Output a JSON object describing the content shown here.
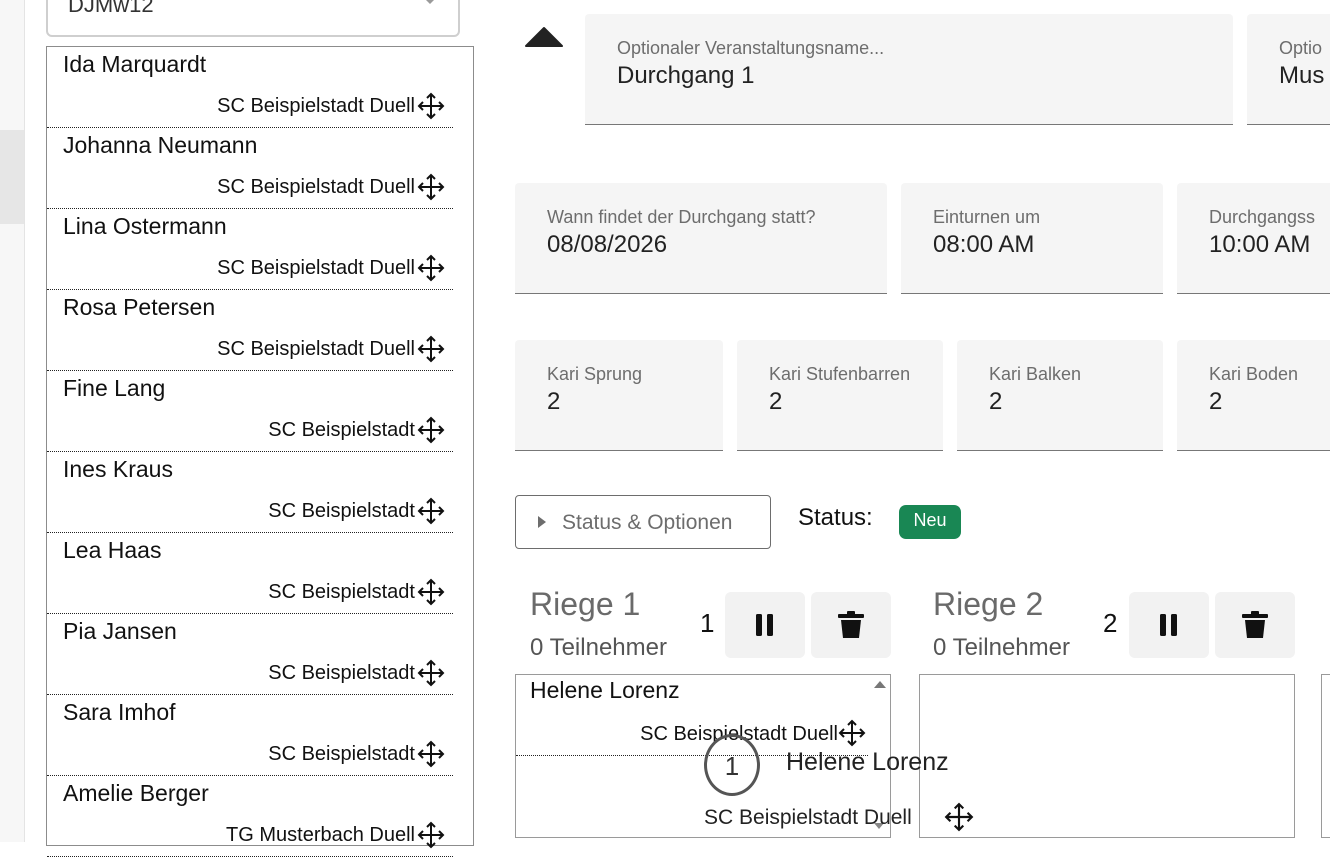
{
  "sidebar": {
    "group_select_value": "DJMw12"
  },
  "athletes": [
    {
      "name": "Ida Marquardt",
      "club": "SC Beispielstadt Duell"
    },
    {
      "name": "Johanna Neumann",
      "club": "SC Beispielstadt Duell"
    },
    {
      "name": "Lina Ostermann",
      "club": "SC Beispielstadt Duell"
    },
    {
      "name": "Rosa Petersen",
      "club": "SC Beispielstadt Duell"
    },
    {
      "name": "Fine Lang",
      "club": "SC Beispielstadt"
    },
    {
      "name": "Ines Kraus",
      "club": "SC Beispielstadt"
    },
    {
      "name": "Lea Haas",
      "club": "SC Beispielstadt"
    },
    {
      "name": "Pia Jansen",
      "club": "SC Beispielstadt"
    },
    {
      "name": "Sara Imhof",
      "club": "SC Beispielstadt"
    },
    {
      "name": "Amelie Berger",
      "club": "TG Musterbach Duell"
    }
  ],
  "event": {
    "name_label": "Optionaler Veranstaltungsname...",
    "name_value": "Durchgang 1",
    "second_label": "Optio",
    "second_value": "Mus",
    "date_label": "Wann findet der Durchgang statt?",
    "date_value": "08/08/2026",
    "warmup_label": "Einturnen um",
    "warmup_value": "08:00 AM",
    "start_label": "Durchgangss",
    "start_value": "10:00 AM"
  },
  "kari": [
    {
      "label": "Kari Sprung",
      "value": "2"
    },
    {
      "label": "Kari Stufenbarren",
      "value": "2"
    },
    {
      "label": "Kari Balken",
      "value": "2"
    },
    {
      "label": "Kari Boden",
      "value": "2"
    }
  ],
  "status": {
    "toggle_label": "Status & Optionen",
    "label": "Status:",
    "badge": "Neu",
    "badge_color": "#198754"
  },
  "riegen": [
    {
      "title": "Riege 1",
      "count": "0 Teilnehmer",
      "number": "1",
      "items": [
        {
          "name": "Helene Lorenz",
          "club": "SC Beispielstadt Duell"
        }
      ]
    },
    {
      "title": "Riege 2",
      "count": "0 Teilnehmer",
      "number": "2",
      "items": []
    }
  ],
  "drag_ghost": {
    "order": "1",
    "name": "Helene Lorenz",
    "club": "SC Beispielstadt Duell"
  },
  "icons": {
    "move": "move-arrows-icon",
    "pause": "pause-icon",
    "delete": "trash-icon",
    "collapse": "chevron-up-icon"
  }
}
